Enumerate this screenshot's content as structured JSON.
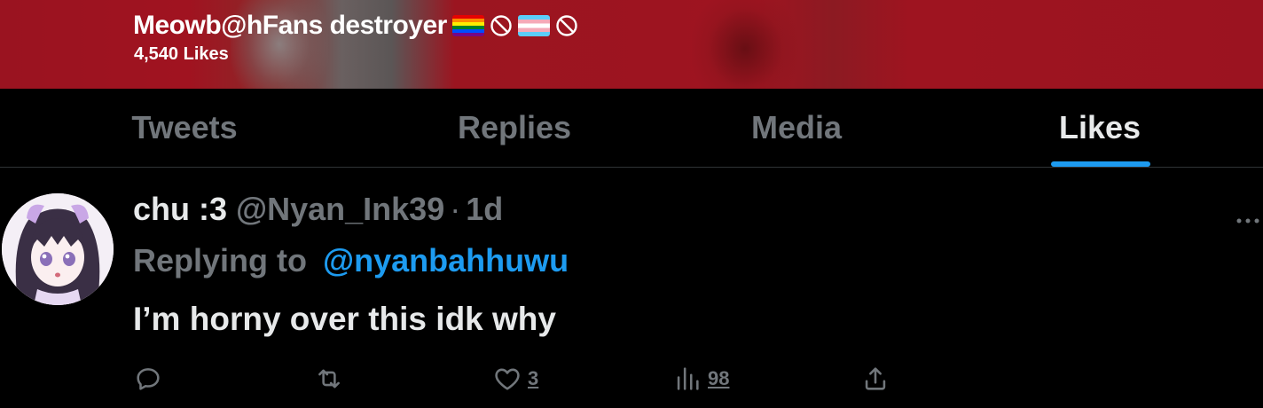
{
  "header": {
    "display_name": "Meowb@hFans destroyer",
    "name_icons": [
      "rainbow-flag-icon",
      "prohibited-icon",
      "trans-flag-icon",
      "prohibited-icon"
    ],
    "likes_count": "4,540 Likes"
  },
  "tabs": [
    {
      "label": "Tweets",
      "active": false
    },
    {
      "label": "Replies",
      "active": false
    },
    {
      "label": "Media",
      "active": false
    },
    {
      "label": "Likes",
      "active": true
    }
  ],
  "tweet": {
    "author_name": "chu :3",
    "author_handle": "@Nyan_Ink39",
    "separator": "·",
    "time": "1d",
    "replying_label": "Replying to",
    "replying_to": "@nyanbahhuwu",
    "text": "I’m horny over this idk why",
    "more_icon": "more-icon",
    "actions": {
      "reply": {
        "icon": "reply-icon",
        "count": ""
      },
      "retweet": {
        "icon": "retweet-icon",
        "count": ""
      },
      "like": {
        "icon": "heart-icon",
        "count": "3"
      },
      "views": {
        "icon": "views-icon",
        "count": "98"
      },
      "share": {
        "icon": "share-icon",
        "count": ""
      }
    }
  },
  "colors": {
    "banner": "#9e1420",
    "accent": "#1d9bf0",
    "muted": "#71767b",
    "text": "#e7e9ea",
    "background": "#000000"
  }
}
